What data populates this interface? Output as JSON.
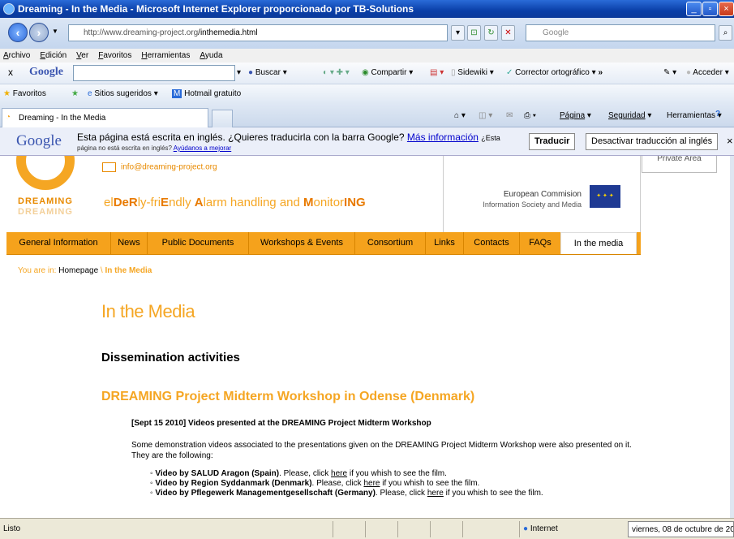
{
  "window": {
    "title": "Dreaming - In the Media - Microsoft Internet Explorer proporcionado por TB-Solutions",
    "url_prefix": "http://www.dreaming-project.org",
    "url_path": "/inthemedia.html",
    "search_placeholder": "Google"
  },
  "menu": [
    "Archivo",
    "Edición",
    "Ver",
    "Favoritos",
    "Herramientas",
    "Ayuda"
  ],
  "google_toolbar": {
    "close": "x",
    "brand": "Google",
    "buscar": "Buscar",
    "compartir": "Compartir",
    "sidewiki": "Sidewiki",
    "corrector": "Corrector ortográfico",
    "more": "»",
    "acceder": "Acceder"
  },
  "favorites": {
    "label": "Favoritos",
    "sugeridos": "Sitios sugeridos",
    "hotmail": "Hotmail gratuito"
  },
  "tabs": {
    "active": "Dreaming - In the Media",
    "commands": [
      "Página",
      "Seguridad",
      "Herramientas"
    ]
  },
  "translate_bar": {
    "logo": "Google",
    "message": "Esta página está escrita en inglés. ¿Quieres traducirla con la barra Google?",
    "more_info": "Más información",
    "more_suffix": "¿Esta",
    "sub_text": "página no está escrita en inglés?",
    "sub_link": "Ayúdanos a mejorar",
    "translate_btn": "Traducir",
    "disable_btn": "Desactivar traducción al inglés",
    "close": "×"
  },
  "site": {
    "email": "info@dreaming-project.org",
    "logo_text": "DREAMING",
    "tagline": [
      "el",
      "De",
      "R",
      "ly-fri",
      "E",
      "ndly ",
      "A",
      "larm handling and ",
      "M",
      "onitor",
      "ING"
    ],
    "eu_line1": "European Commision",
    "eu_line2": "Information Society and Media",
    "private_area": "Private Area",
    "nav": [
      {
        "label": "General Information",
        "w": 0
      },
      {
        "label": "News"
      },
      {
        "label": "Public Documents"
      },
      {
        "label": "Workshops & Events"
      },
      {
        "label": "Consortium"
      },
      {
        "label": "Links"
      },
      {
        "label": "Contacts"
      },
      {
        "label": "FAQs"
      },
      {
        "label": "In the media"
      }
    ],
    "breadcrumb_prefix": "You are in: ",
    "breadcrumb_home": "Homepage",
    "breadcrumb_sep": " \\ ",
    "breadcrumb_current": "In the Media",
    "heading": "In the Media",
    "section": "Dissemination activities",
    "event_title": "DREAMING Project Midterm Workshop in Odense (Denmark)",
    "news_title": "[Sept 15 2010] Videos presented at the DREAMING Project Midterm Workshop",
    "paragraph": "Some demonstration videos associated to the presentations given on the DREAMING Project Midterm Workshop were also presented on it. They are the following:",
    "videos": [
      {
        "title": "Video by SALUD Aragon (Spain)",
        "pre": ". Please, click ",
        "link": "here",
        "post": " if you whish to see the film."
      },
      {
        "title": "Video by Region Syddanmark (Denmark)",
        "pre": ". Please, click ",
        "link": "here",
        "post": " if you whish to see the film."
      },
      {
        "title": "Video by Pflegewerk Managementgesellschaft (Germany)",
        "pre": ". Please, click ",
        "link": "here",
        "post": " if you whish to see the film."
      }
    ]
  },
  "status": {
    "left": "Listo",
    "zone": "Internet",
    "date": "viernes, 08 de octubre de 201"
  }
}
